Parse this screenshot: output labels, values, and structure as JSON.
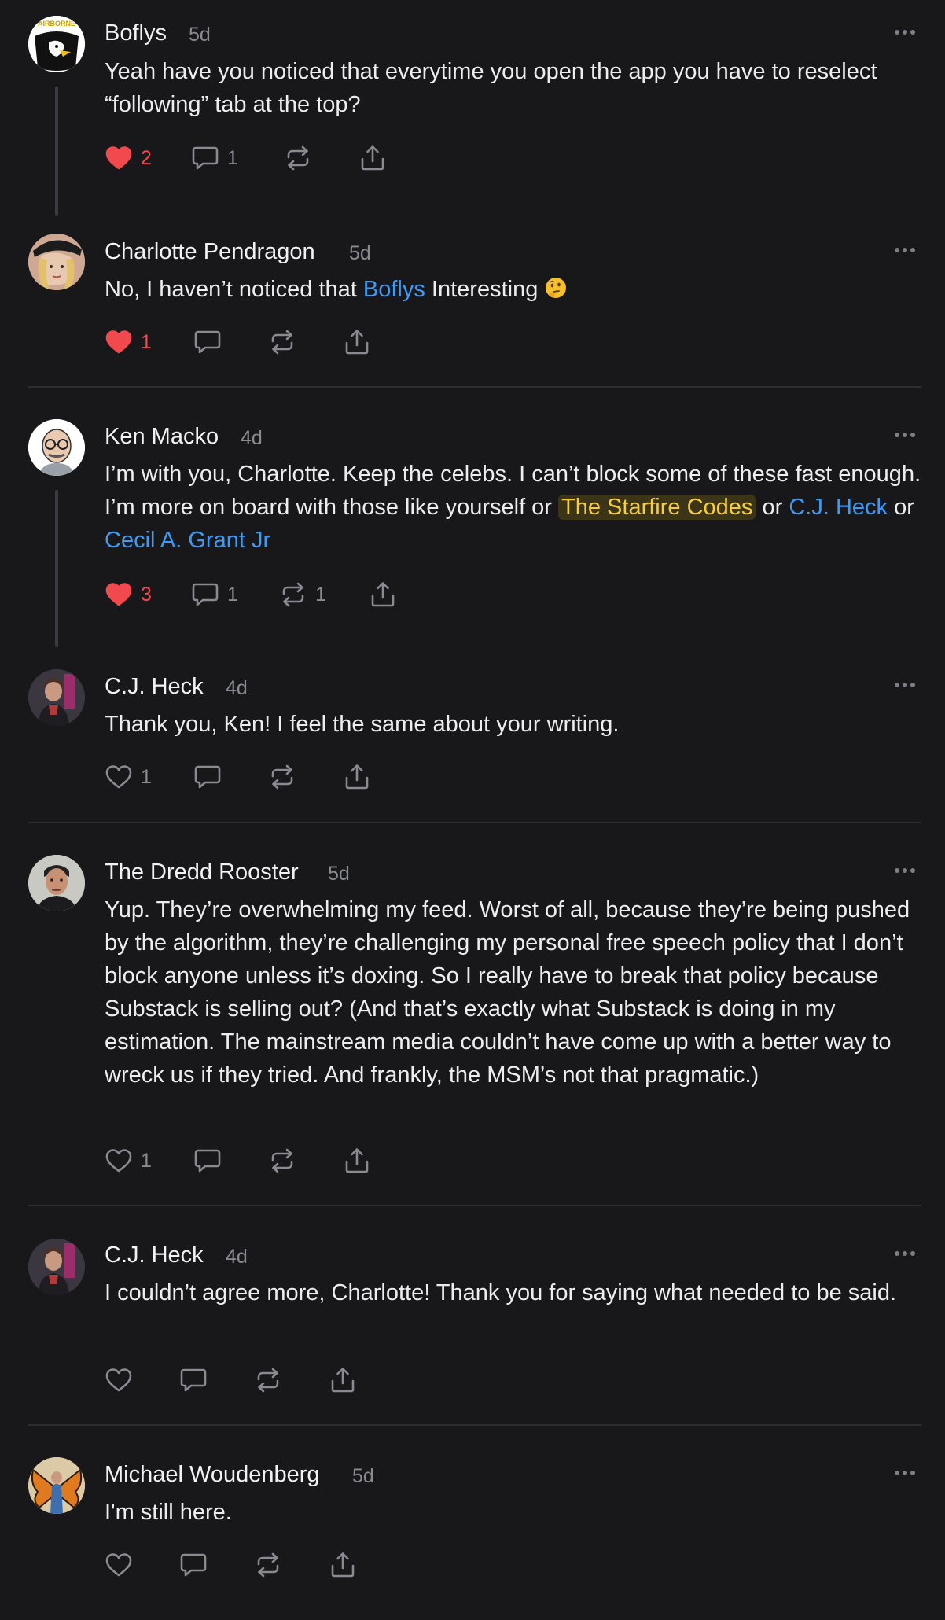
{
  "comments": [
    {
      "author": "Boflys",
      "time": "5d",
      "text": "Yeah have you noticed that everytime you open the app you have to reselect “following” tab at the top?",
      "likes": "2",
      "replies": "1",
      "restacks": ""
    },
    {
      "author": "Charlotte Pendragon",
      "time": "5d",
      "text_a": "No, I haven’t noticed that ",
      "mention": "Boflys",
      "text_b": " Interesting ",
      "likes": "1",
      "replies": "",
      "restacks": ""
    },
    {
      "author": "Ken Macko",
      "time": "4d",
      "text_a": "I’m with you, Charlotte. Keep the celebs. I can’t block some of these fast enough. I’m more on board with those like yourself or ",
      "highlight": "The Starfire Codes",
      "text_b": " or ",
      "mention1": "C.J. Heck",
      "text_c": " or ",
      "mention2": "Cecil A. Grant Jr",
      "likes": "3",
      "replies": "1",
      "restacks": "1"
    },
    {
      "author": "C.J. Heck",
      "time": "4d",
      "text": "Thank you, Ken! I feel the same about your writing.",
      "likes": "1",
      "replies": "",
      "restacks": ""
    },
    {
      "author": "The Dredd Rooster",
      "time": "5d",
      "text": "Yup. They’re overwhelming my feed. Worst of all, because they’re being pushed by the algorithm, they’re challenging my personal free speech policy that I don’t block anyone unless it’s doxing. So I really have to break that policy because Substack is selling out? (And that’s exactly what Substack is doing in my estimation. The mainstream media couldn’t have come up with a better way to wreck us if they tried. And frankly, the MSM’s not that pragmatic.)",
      "likes": "1",
      "replies": "",
      "restacks": ""
    },
    {
      "author": "C.J. Heck",
      "time": "4d",
      "text": "I couldn’t agree more, Charlotte! Thank you for saying what needed to be said.",
      "likes": "",
      "replies": "",
      "restacks": ""
    },
    {
      "author": "Michael Woudenberg",
      "time": "5d",
      "text": "I'm still here.",
      "likes": "",
      "replies": "",
      "restacks": ""
    }
  ],
  "colors": {
    "background": "#18181b",
    "mention": "#3d9bf5",
    "liked": "#f2494f",
    "highlight": "#f5cd3d",
    "muted": "#8a8a92"
  },
  "icons": [
    "heart-icon",
    "comment-icon",
    "restack-icon",
    "share-icon",
    "more-icon"
  ]
}
